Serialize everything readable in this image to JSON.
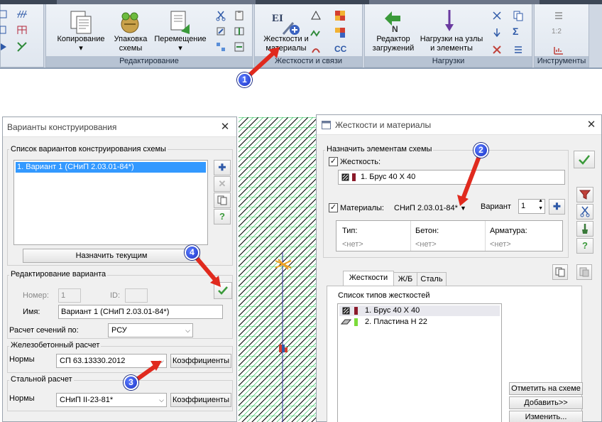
{
  "ribbon": {
    "groups": {
      "editing": "Редактирование",
      "stiffness": "Жесткости и связи",
      "loads": "Нагрузки",
      "tools": "Инструменты"
    },
    "buttons": {
      "copy": "Копирование",
      "pack_1": "Упаковка",
      "pack_2": "схемы",
      "move": "Перемещение",
      "stiff_1": "Жесткости и",
      "stiff_2": "материалы",
      "load_editor_1": "Редактор",
      "load_editor_2": "загружений",
      "loads_nodes_1": "Нагрузки на узлы",
      "loads_nodes_2": "и элементы",
      "ei_glyph": "EI",
      "cc_glyph": "CC",
      "sigma_glyph": "Σ",
      "scale_glyph": "1:2"
    }
  },
  "variants_window": {
    "title": "Варианты конструирования",
    "list_legend": "Список вариантов конструирования схемы",
    "list_items": [
      "1. Вариант 1 (СНиП 2.03.01-84*)"
    ],
    "assign_current": "Назначить текущим",
    "edit_legend": "Редактирование варианта",
    "number_label": "Номер:",
    "number_value": "1",
    "id_label": "ID:",
    "name_label": "Имя:",
    "name_value": "Вариант 1 (СНиП 2.03.01-84*)",
    "calc_label": "Расчет сечений по:",
    "calc_value": "РСУ",
    "rc_legend": "Железобетонный  расчет",
    "rc_norms_label": "Нормы",
    "rc_norms_value": "СП 63.13330.2012",
    "coefficients": "Коэффициенты",
    "steel_legend": "Стальной расчет",
    "steel_norms_label": "Нормы",
    "steel_norms_value": "СНиП II-23-81*",
    "coefficients_2": "Коэффициенты",
    "side_help": "?"
  },
  "stiff_window": {
    "title": "Жесткости и материалы",
    "assign_legend": "Назначить элементам схемы",
    "stiffness_label": "Жесткость:",
    "stiffness_value": "1. Брус 40 X 40",
    "materials_label": "Материалы:",
    "materials_value": "СНиП 2.03.01-84*",
    "variant_label": "Вариант",
    "variant_value": "1",
    "mat_headers": [
      "Тип:",
      "Бетон:",
      "Арматура:"
    ],
    "mat_values": [
      "<нет>",
      "<нет>",
      "<нет>"
    ],
    "tabs": [
      "Жесткости",
      "Ж/Б",
      "Сталь"
    ],
    "types_legend": "Список типов жесткостей",
    "types": [
      "1. Брус 40 X 40",
      "2. Пластина  Н 22"
    ],
    "mark_on_scheme": "Отметить на схеме",
    "add": "Добавить>>",
    "change": "Изменить...",
    "side_help": "?"
  },
  "callouts": [
    "1",
    "2",
    "3",
    "4"
  ],
  "colors": {
    "list_selection": "#3399ff",
    "callout_blue": "#1a33c8",
    "stiffness_swatch": "#8b1a2a",
    "plate_swatch": "#7cdb3a",
    "mesh_green": "#19b84a"
  }
}
